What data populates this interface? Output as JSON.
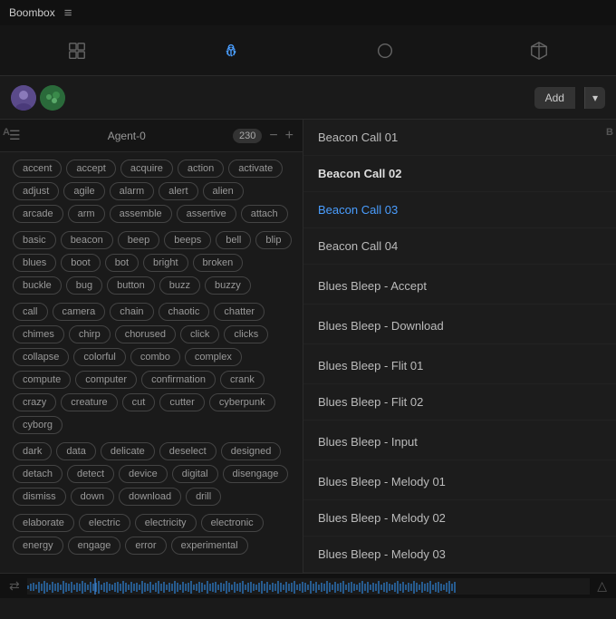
{
  "app": {
    "title": "Boombox",
    "menu_icon": "≡"
  },
  "navbar": {
    "icons": [
      {
        "name": "grid-icon",
        "active": false,
        "unicode": "⊞"
      },
      {
        "name": "agent-icon",
        "active": true,
        "unicode": "⬡"
      },
      {
        "name": "circle-icon",
        "active": false,
        "unicode": "○"
      },
      {
        "name": "box-icon",
        "active": false,
        "unicode": "◻"
      }
    ]
  },
  "agent_bar": {
    "add_label": "Add",
    "agent_name": "Agent-0",
    "count": "230"
  },
  "left_panel": {
    "toggle_icon": "☰",
    "minus_icon": "−",
    "plus_icon": "+",
    "section_a_label": "A",
    "section_b_label": "B",
    "tags": {
      "a_section": [
        "accent",
        "accept",
        "acquire",
        "action",
        "activate",
        "adjust",
        "agile",
        "alarm",
        "alert",
        "alien",
        "arcade",
        "arm",
        "assemble",
        "assertive",
        "attach"
      ],
      "b_section": [
        "basic",
        "beacon",
        "beep",
        "beeps",
        "bell",
        "blip",
        "blues",
        "boot",
        "bot",
        "bright",
        "broken",
        "buckle",
        "bug",
        "button",
        "buzz",
        "buzzy"
      ]
    }
  },
  "c_section_tags": [
    "call",
    "camera",
    "chain",
    "chaotic",
    "chatter",
    "chimes",
    "chirp",
    "chorused",
    "click",
    "clicks",
    "collapse",
    "colorful",
    "combo",
    "complex",
    "compute",
    "computer",
    "confirmation",
    "crank",
    "crazy",
    "creature",
    "cut",
    "cutter",
    "cyberpunk",
    "cyborg"
  ],
  "d_section_tags": [
    "dark",
    "data",
    "delicate",
    "deselect",
    "designed",
    "detach",
    "detect",
    "device",
    "digital",
    "disengage",
    "dismiss",
    "down",
    "download",
    "drill"
  ],
  "e_section_tags": [
    "elaborate",
    "electric",
    "electricity",
    "electronic",
    "energy",
    "engage",
    "error",
    "experimental"
  ],
  "right_panel": {
    "items": [
      {
        "label": "Beacon Call 01",
        "style": "normal"
      },
      {
        "label": "Beacon Call 02",
        "style": "bold"
      },
      {
        "label": "Beacon Call 03",
        "style": "active"
      },
      {
        "label": "Beacon Call 04",
        "style": "normal"
      },
      {
        "label": "Blues Bleep - Accept",
        "style": "normal"
      },
      {
        "label": "Blues Bleep - Download",
        "style": "normal"
      },
      {
        "label": "Blues Bleep - Flit 01",
        "style": "normal"
      },
      {
        "label": "Blues Bleep - Flit 02",
        "style": "normal"
      },
      {
        "label": "Blues Bleep - Input",
        "style": "normal"
      },
      {
        "label": "Blues Bleep - Melody 01",
        "style": "normal"
      },
      {
        "label": "Blues Bleep - Melody 02",
        "style": "normal"
      },
      {
        "label": "Blues Bleep - Melody 03",
        "style": "normal"
      }
    ]
  },
  "bottom_bar": {
    "transport_icon": "⇄",
    "warn_icon": "△"
  }
}
